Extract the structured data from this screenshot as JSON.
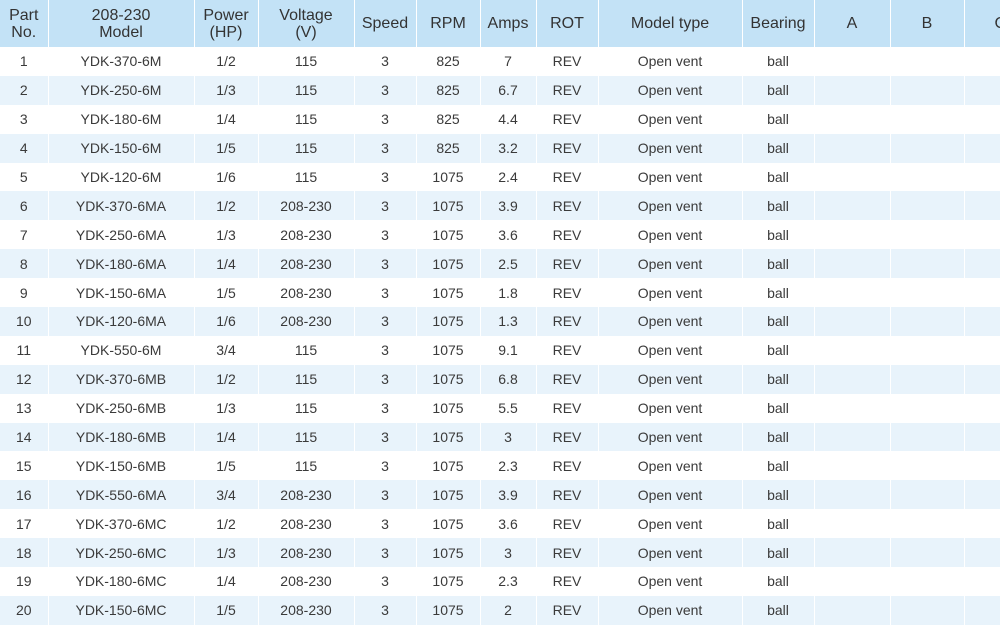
{
  "colors": {
    "header_bg": "#c3e2f6",
    "row_alt_bg": "#e8f3fb",
    "row_bg": "#ffffff",
    "text": "#3a3a3a"
  },
  "header": {
    "part_no_l1": "Part",
    "part_no_l2": "No.",
    "model_l1": "208-230",
    "model_l2": "Model",
    "power_l1": "Power",
    "power_l2": "(HP)",
    "voltage_l1": "Voltage",
    "voltage_l2": "(V)",
    "speed": "Speed",
    "rpm": "RPM",
    "amps": "Amps",
    "rot": "ROT",
    "model_type": "Model type",
    "bearing": "Bearing",
    "a": "A",
    "b": "B",
    "c": "C"
  },
  "rows": [
    {
      "part": "1",
      "model": "YDK-370-6M",
      "power": "1/2",
      "voltage": "115",
      "speed": "3",
      "rpm": "825",
      "amps": "7",
      "rot": "REV",
      "type": "Open vent",
      "bearing": "ball",
      "a": "",
      "b": "",
      "c": ""
    },
    {
      "part": "2",
      "model": "YDK-250-6M",
      "power": "1/3",
      "voltage": "115",
      "speed": "3",
      "rpm": "825",
      "amps": "6.7",
      "rot": "REV",
      "type": "Open vent",
      "bearing": "ball",
      "a": "",
      "b": "",
      "c": ""
    },
    {
      "part": "3",
      "model": "YDK-180-6M",
      "power": "1/4",
      "voltage": "115",
      "speed": "3",
      "rpm": "825",
      "amps": "4.4",
      "rot": "REV",
      "type": "Open vent",
      "bearing": "ball",
      "a": "",
      "b": "",
      "c": ""
    },
    {
      "part": "4",
      "model": "YDK-150-6M",
      "power": "1/5",
      "voltage": "115",
      "speed": "3",
      "rpm": "825",
      "amps": "3.2",
      "rot": "REV",
      "type": "Open vent",
      "bearing": "ball",
      "a": "",
      "b": "",
      "c": ""
    },
    {
      "part": "5",
      "model": "YDK-120-6M",
      "power": "1/6",
      "voltage": "115",
      "speed": "3",
      "rpm": "1075",
      "amps": "2.4",
      "rot": "REV",
      "type": "Open vent",
      "bearing": "ball",
      "a": "",
      "b": "",
      "c": ""
    },
    {
      "part": "6",
      "model": "YDK-370-6MA",
      "power": "1/2",
      "voltage": "208-230",
      "speed": "3",
      "rpm": "1075",
      "amps": "3.9",
      "rot": "REV",
      "type": "Open vent",
      "bearing": "ball",
      "a": "",
      "b": "",
      "c": ""
    },
    {
      "part": "7",
      "model": "YDK-250-6MA",
      "power": "1/3",
      "voltage": "208-230",
      "speed": "3",
      "rpm": "1075",
      "amps": "3.6",
      "rot": "REV",
      "type": "Open vent",
      "bearing": "ball",
      "a": "",
      "b": "",
      "c": ""
    },
    {
      "part": "8",
      "model": "YDK-180-6MA",
      "power": "1/4",
      "voltage": "208-230",
      "speed": "3",
      "rpm": "1075",
      "amps": "2.5",
      "rot": "REV",
      "type": "Open vent",
      "bearing": "ball",
      "a": "",
      "b": "",
      "c": ""
    },
    {
      "part": "9",
      "model": "YDK-150-6MA",
      "power": "1/5",
      "voltage": "208-230",
      "speed": "3",
      "rpm": "1075",
      "amps": "1.8",
      "rot": "REV",
      "type": "Open vent",
      "bearing": "ball",
      "a": "",
      "b": "",
      "c": ""
    },
    {
      "part": "10",
      "model": "YDK-120-6MA",
      "power": "1/6",
      "voltage": "208-230",
      "speed": "3",
      "rpm": "1075",
      "amps": "1.3",
      "rot": "REV",
      "type": "Open vent",
      "bearing": "ball",
      "a": "",
      "b": "",
      "c": ""
    },
    {
      "part": "11",
      "model": "YDK-550-6M",
      "power": "3/4",
      "voltage": "115",
      "speed": "3",
      "rpm": "1075",
      "amps": "9.1",
      "rot": "REV",
      "type": "Open vent",
      "bearing": "ball",
      "a": "",
      "b": "",
      "c": ""
    },
    {
      "part": "12",
      "model": "YDK-370-6MB",
      "power": "1/2",
      "voltage": "115",
      "speed": "3",
      "rpm": "1075",
      "amps": "6.8",
      "rot": "REV",
      "type": "Open vent",
      "bearing": "ball",
      "a": "",
      "b": "",
      "c": ""
    },
    {
      "part": "13",
      "model": "YDK-250-6MB",
      "power": "1/3",
      "voltage": "115",
      "speed": "3",
      "rpm": "1075",
      "amps": "5.5",
      "rot": "REV",
      "type": "Open vent",
      "bearing": "ball",
      "a": "",
      "b": "",
      "c": ""
    },
    {
      "part": "14",
      "model": "YDK-180-6MB",
      "power": "1/4",
      "voltage": "115",
      "speed": "3",
      "rpm": "1075",
      "amps": "3",
      "rot": "REV",
      "type": "Open vent",
      "bearing": "ball",
      "a": "",
      "b": "",
      "c": ""
    },
    {
      "part": "15",
      "model": "YDK-150-6MB",
      "power": "1/5",
      "voltage": "115",
      "speed": "3",
      "rpm": "1075",
      "amps": "2.3",
      "rot": "REV",
      "type": "Open vent",
      "bearing": "ball",
      "a": "",
      "b": "",
      "c": ""
    },
    {
      "part": "16",
      "model": "YDK-550-6MA",
      "power": "3/4",
      "voltage": "208-230",
      "speed": "3",
      "rpm": "1075",
      "amps": "3.9",
      "rot": "REV",
      "type": "Open vent",
      "bearing": "ball",
      "a": "",
      "b": "",
      "c": ""
    },
    {
      "part": "17",
      "model": "YDK-370-6MC",
      "power": "1/2",
      "voltage": "208-230",
      "speed": "3",
      "rpm": "1075",
      "amps": "3.6",
      "rot": "REV",
      "type": "Open vent",
      "bearing": "ball",
      "a": "",
      "b": "",
      "c": ""
    },
    {
      "part": "18",
      "model": "YDK-250-6MC",
      "power": "1/3",
      "voltage": "208-230",
      "speed": "3",
      "rpm": "1075",
      "amps": "3",
      "rot": "REV",
      "type": "Open vent",
      "bearing": "ball",
      "a": "",
      "b": "",
      "c": ""
    },
    {
      "part": "19",
      "model": "YDK-180-6MC",
      "power": "1/4",
      "voltage": "208-230",
      "speed": "3",
      "rpm": "1075",
      "amps": "2.3",
      "rot": "REV",
      "type": "Open vent",
      "bearing": "ball",
      "a": "",
      "b": "",
      "c": ""
    },
    {
      "part": "20",
      "model": "YDK-150-6MC",
      "power": "1/5",
      "voltage": "208-230",
      "speed": "3",
      "rpm": "1075",
      "amps": "2",
      "rot": "REV",
      "type": "Open vent",
      "bearing": "ball",
      "a": "",
      "b": "",
      "c": ""
    }
  ]
}
